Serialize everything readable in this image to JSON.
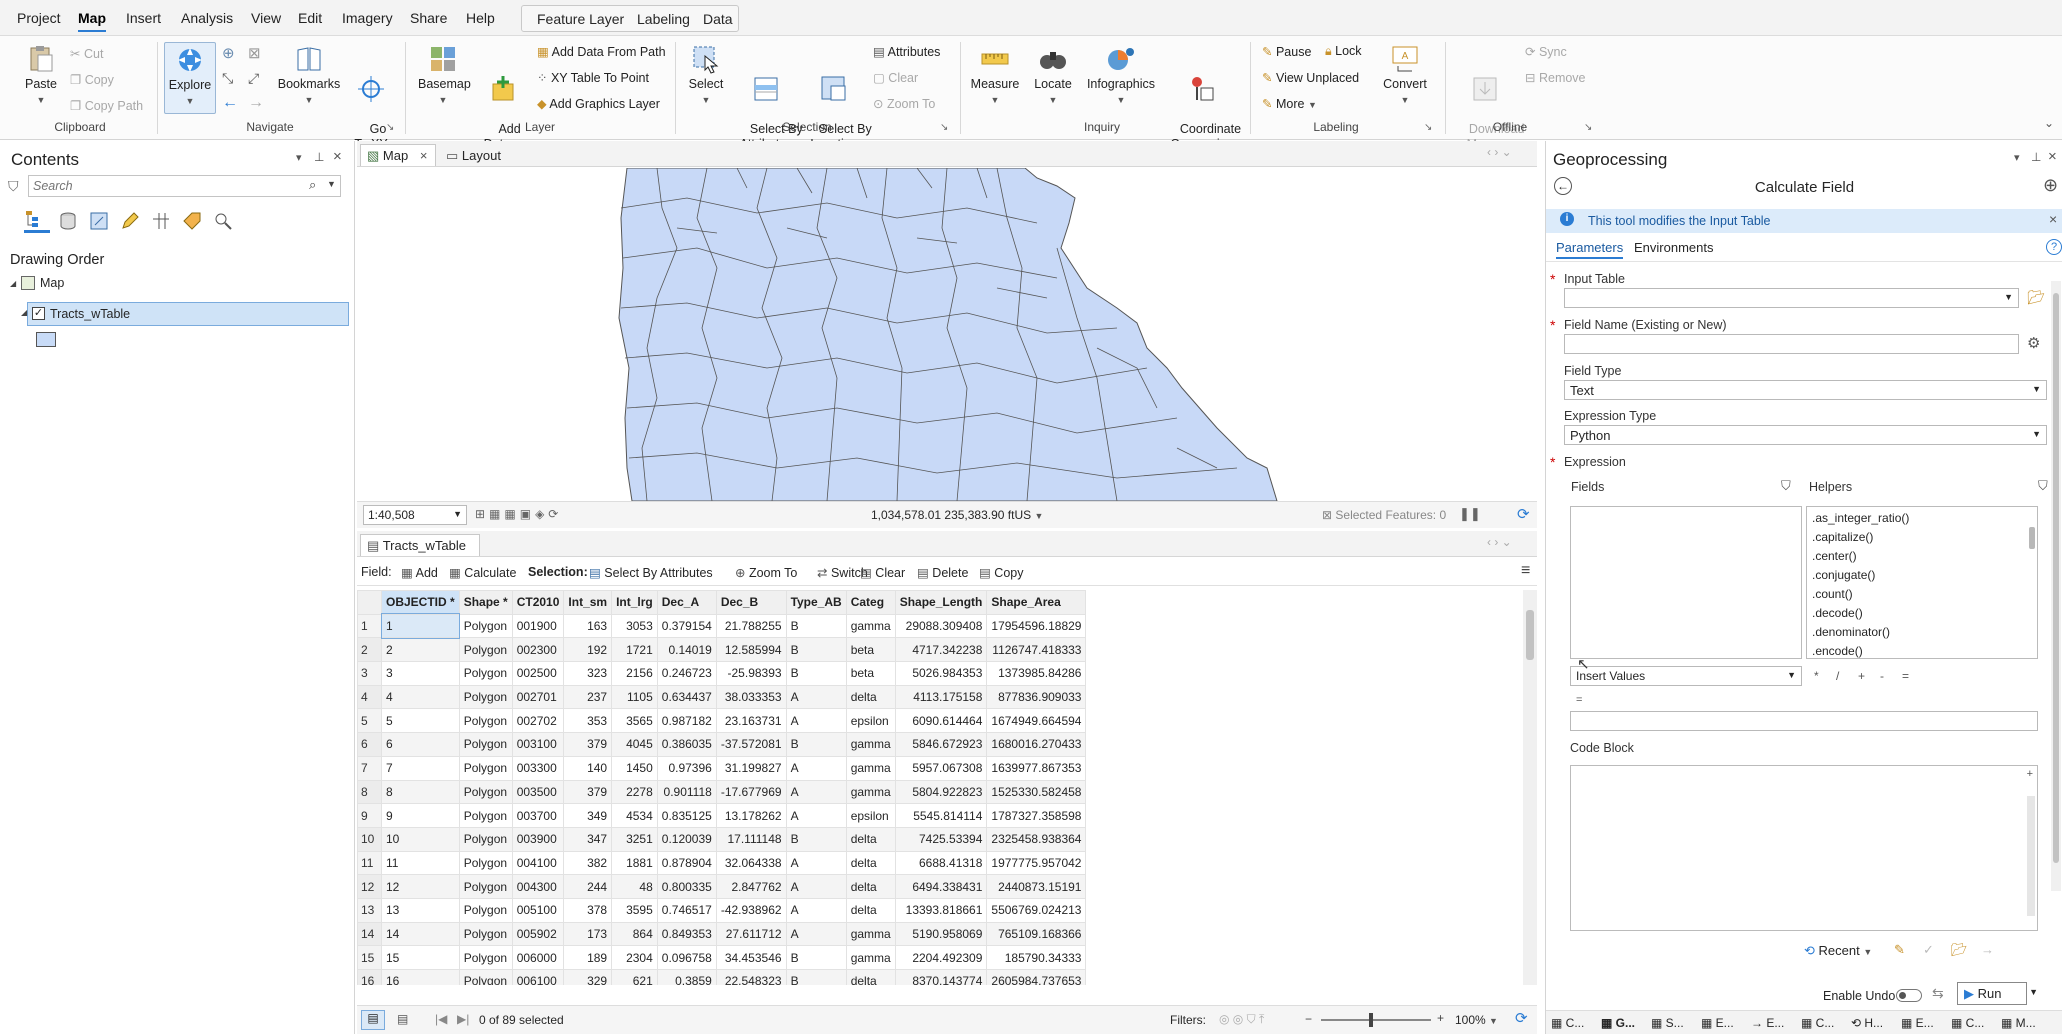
{
  "menu": {
    "items": [
      "Project",
      "Map",
      "Insert",
      "Analysis",
      "View",
      "Edit",
      "Imagery",
      "Share",
      "Help"
    ],
    "selected": "Map",
    "context_tabs": [
      "Feature Layer",
      "Labeling",
      "Data"
    ]
  },
  "ribbon": {
    "clipboard": {
      "paste": "Paste",
      "cut": "Cut",
      "copy": "Copy",
      "copy_path": "Copy Path",
      "label": "Clipboard"
    },
    "navigate": {
      "explore": "Explore",
      "bookmarks": "Bookmarks",
      "go_to_xy": "Go\nTo XY",
      "label": "Navigate"
    },
    "layer": {
      "basemap": "Basemap",
      "add_data": "Add\nData",
      "add_data_from_path": "Add Data From Path",
      "xy_table": "XY Table To Point",
      "add_graphics": "Add Graphics Layer",
      "label": "Layer"
    },
    "selection": {
      "select": "Select",
      "select_by_attributes": "Select By\nAttributes",
      "select_by_location": "Select By\nLocation",
      "attributes": "Attributes",
      "clear": "Clear",
      "zoom_to": "Zoom To",
      "label": "Selection"
    },
    "inquiry": {
      "measure": "Measure",
      "locate": "Locate",
      "infographics": "Infographics",
      "coordinate_conversion": "Coordinate\nConversion",
      "label": "Inquiry"
    },
    "labeling": {
      "pause": "Pause",
      "lock": "Lock",
      "view_unplaced": "View Unplaced",
      "more": "More",
      "convert": "Convert",
      "label": "Labeling"
    },
    "offline": {
      "download_map": "Download\nMap",
      "sync": "Sync",
      "remove": "Remove",
      "label": "Offline"
    }
  },
  "contents": {
    "title": "Contents",
    "search_placeholder": "Search",
    "drawing_order": "Drawing Order",
    "map": "Map",
    "layer": "Tracts_wTable"
  },
  "map_view": {
    "tabs": [
      "Map",
      "Layout"
    ],
    "scale": "1:40,508",
    "coords": "1,034,578.01 235,383.90 ftUS",
    "selected_features": "Selected Features: 0"
  },
  "table_view": {
    "tab": "Tracts_wTable",
    "toolbar": {
      "field": "Field:",
      "add": "Add",
      "calculate": "Calculate",
      "selection": "Selection:",
      "select_by_attributes": "Select By Attributes",
      "zoom_to": "Zoom To",
      "switch": "Switch",
      "clear": "Clear",
      "delete": "Delete",
      "copy": "Copy"
    },
    "columns": [
      "OBJECTID *",
      "Shape *",
      "CT2010",
      "Int_sm",
      "Int_lrg",
      "Dec_A",
      "Dec_B",
      "Type_AB",
      "Categ",
      "Shape_Length",
      "Shape_Area"
    ],
    "rows": [
      [
        "1",
        "1",
        "Polygon",
        "001900",
        "163",
        "3053",
        "0.379154",
        "21.788255",
        "B",
        "gamma",
        "29088.309408",
        "17954596.18829"
      ],
      [
        "2",
        "2",
        "Polygon",
        "002300",
        "192",
        "1721",
        "0.14019",
        "12.585994",
        "B",
        "beta",
        "4717.342238",
        "1126747.418333"
      ],
      [
        "3",
        "3",
        "Polygon",
        "002500",
        "323",
        "2156",
        "0.246723",
        "-25.98393",
        "B",
        "beta",
        "5026.984353",
        "1373985.84286"
      ],
      [
        "4",
        "4",
        "Polygon",
        "002701",
        "237",
        "1105",
        "0.634437",
        "38.033353",
        "A",
        "delta",
        "4113.175158",
        "877836.909033"
      ],
      [
        "5",
        "5",
        "Polygon",
        "002702",
        "353",
        "3565",
        "0.987182",
        "23.163731",
        "A",
        "epsilon",
        "6090.614464",
        "1674949.664594"
      ],
      [
        "6",
        "6",
        "Polygon",
        "003100",
        "379",
        "4045",
        "0.386035",
        "-37.572081",
        "B",
        "gamma",
        "5846.672923",
        "1680016.270433"
      ],
      [
        "7",
        "7",
        "Polygon",
        "003300",
        "140",
        "1450",
        "0.97396",
        "31.199827",
        "A",
        "gamma",
        "5957.067308",
        "1639977.867353"
      ],
      [
        "8",
        "8",
        "Polygon",
        "003500",
        "379",
        "2278",
        "0.901118",
        "-17.677969",
        "A",
        "gamma",
        "5804.922823",
        "1525330.582458"
      ],
      [
        "9",
        "9",
        "Polygon",
        "003700",
        "349",
        "4534",
        "0.835125",
        "13.178262",
        "A",
        "epsilon",
        "5545.814114",
        "1787327.358598"
      ],
      [
        "10",
        "10",
        "Polygon",
        "003900",
        "347",
        "3251",
        "0.120039",
        "17.111148",
        "B",
        "delta",
        "7425.53394",
        "2325458.938364"
      ],
      [
        "11",
        "11",
        "Polygon",
        "004100",
        "382",
        "1881",
        "0.878904",
        "32.064338",
        "A",
        "delta",
        "6688.41318",
        "1977775.957042"
      ],
      [
        "12",
        "12",
        "Polygon",
        "004300",
        "244",
        "48",
        "0.800335",
        "2.847762",
        "A",
        "delta",
        "6494.338431",
        "2440873.15191"
      ],
      [
        "13",
        "13",
        "Polygon",
        "005100",
        "378",
        "3595",
        "0.746517",
        "-42.938962",
        "A",
        "delta",
        "13393.818661",
        "5506769.024213"
      ],
      [
        "14",
        "14",
        "Polygon",
        "005902",
        "173",
        "864",
        "0.849353",
        "27.611712",
        "A",
        "gamma",
        "5190.958069",
        "765109.168366"
      ],
      [
        "15",
        "15",
        "Polygon",
        "006000",
        "189",
        "2304",
        "0.096758",
        "34.453546",
        "B",
        "gamma",
        "2204.492309",
        "185790.34333"
      ],
      [
        "16",
        "16",
        "Polygon",
        "006100",
        "329",
        "621",
        "0.3859",
        "22.548323",
        "B",
        "delta",
        "8370.143774",
        "2605984.737653"
      ]
    ],
    "status": "0 of 89 selected",
    "filters": "Filters:",
    "zoom": "100%"
  },
  "geoprocessing": {
    "title": "Geoprocessing",
    "tool": "Calculate Field",
    "banner": "This tool modifies the Input Table",
    "tabs": [
      "Parameters",
      "Environments"
    ],
    "input_table": "Input Table",
    "field_name": "Field Name (Existing or New)",
    "field_type": "Field Type",
    "field_type_value": "Text",
    "expression_type": "Expression Type",
    "expression_type_value": "Python",
    "expression": "Expression",
    "fields": "Fields",
    "helpers": "Helpers",
    "helper_items": [
      ".as_integer_ratio()",
      ".capitalize()",
      ".center()",
      ".conjugate()",
      ".count()",
      ".decode()",
      ".denominator()",
      ".encode()"
    ],
    "insert_values": "Insert Values",
    "operators": [
      "*",
      "/",
      "+",
      "-",
      "="
    ],
    "equals": "=",
    "code_block": "Code Block",
    "recent": "Recent",
    "enable_undo": "Enable Undo",
    "run": "Run",
    "bottom_tabs": [
      "C...",
      "G...",
      "S...",
      "E...",
      "E...",
      "C...",
      "H...",
      "E...",
      "C...",
      "M..."
    ]
  }
}
